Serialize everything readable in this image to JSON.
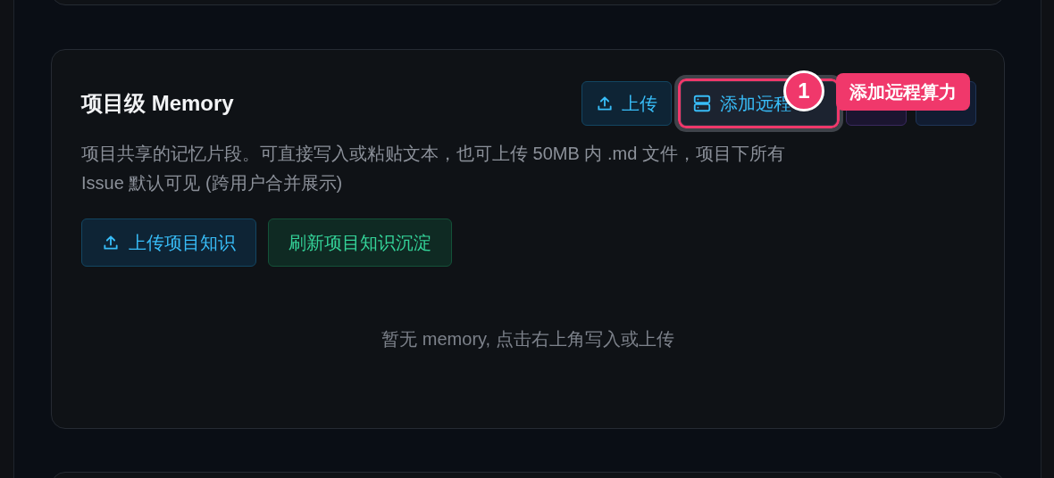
{
  "card": {
    "title": "项目级 Memory",
    "header_buttons": [
      {
        "kind": "upload",
        "label": "上传"
      },
      {
        "kind": "server",
        "label": "添加远程",
        "highlighted": true
      },
      {
        "kind": "purple"
      },
      {
        "kind": "blue"
      }
    ],
    "description": "项目共享的记忆片段。可直接写入或粘贴文本，也可上传 50MB 内 .md 文件，项目下所有 Issue 默认可见 (跨用户合并展示)",
    "actions": [
      {
        "kind": "upload",
        "label": "上传项目知识"
      },
      {
        "kind": "refresh",
        "label": "刷新项目知识沉淀"
      }
    ],
    "empty_text": "暂无 memory, 点击右上角写入或上传"
  },
  "callout": {
    "number": "1",
    "label": "添加远程算力"
  }
}
